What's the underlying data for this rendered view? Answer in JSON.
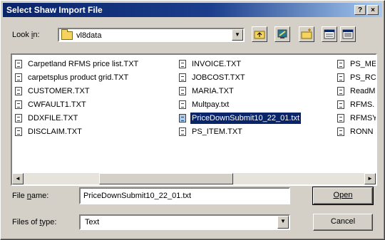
{
  "window": {
    "title": "Select Shaw Import File",
    "help_glyph": "?",
    "close_glyph": "×"
  },
  "look_in": {
    "label_pre": "Look ",
    "label_key": "i",
    "label_post": "n:",
    "value": "vl8data",
    "drop_glyph": "▼"
  },
  "toolbar": {
    "icons": [
      "up-folder-icon",
      "desktop-icon",
      "new-folder-icon",
      "list-view-icon",
      "details-view-icon"
    ]
  },
  "files": {
    "columns": [
      [
        "Carpetland RFMS price list.TXT",
        "carpetsplus product grid.TXT",
        "CUSTOMER.TXT",
        "CWFAULT1.TXT",
        "DDXFILE.TXT",
        "DISCLAIM.TXT"
      ],
      [
        "INVOICE.TXT",
        "JOBCOST.TXT",
        "MARIA.TXT",
        "Multpay.txt",
        "PriceDownSubmit10_22_01.txt",
        "PS_ITEM.TXT"
      ],
      [
        "PS_ME",
        "PS_RC",
        "ReadM",
        "RFMS.",
        "RFMSY",
        "RONN"
      ]
    ],
    "selected": "PriceDownSubmit10_22_01.txt"
  },
  "scroll": {
    "left_glyph": "◄",
    "right_glyph": "►"
  },
  "file_name": {
    "label_pre": "File ",
    "label_key": "n",
    "label_post": "ame:",
    "value": "PriceDownSubmit10_22_01.txt"
  },
  "file_type": {
    "label_pre": "Files of ",
    "label_key": "t",
    "label_post": "ype:",
    "value": "Text",
    "drop_glyph": "▼"
  },
  "buttons": {
    "open": "Open",
    "cancel": "Cancel"
  }
}
